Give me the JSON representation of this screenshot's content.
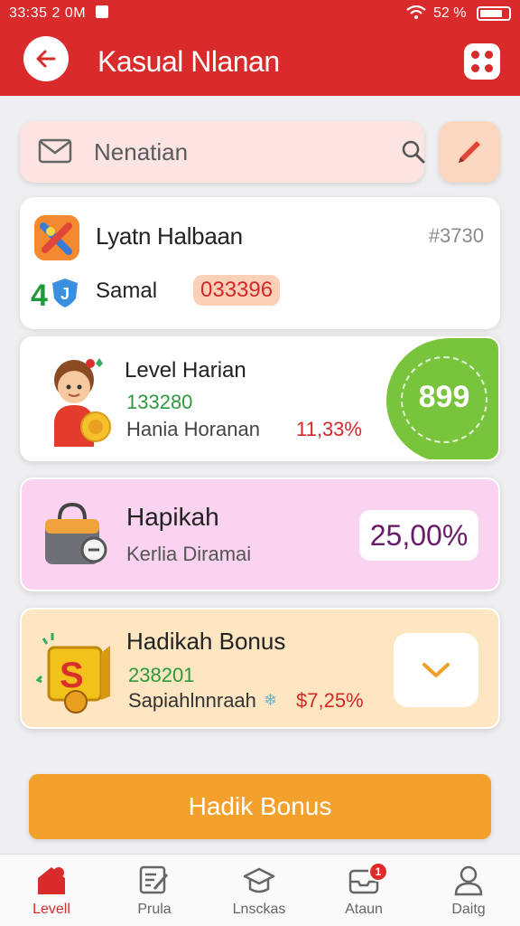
{
  "status_bar": {
    "time": "33:35 2 0M",
    "battery_text": "52 %"
  },
  "header": {
    "title": "Kasual Nlanan"
  },
  "search": {
    "placeholder": "Nenatian"
  },
  "summary": {
    "name": "Lyatn Halbaan",
    "code": "#3730",
    "level_number": "4",
    "subname": "Samal",
    "badge": "033396"
  },
  "level_card": {
    "title": "Level Harian",
    "value": "133280",
    "subtitle": "Hania Horanan",
    "percent": "11,33%",
    "score": "899"
  },
  "pink_card": {
    "title": "Hapikah",
    "subtitle": "Kerlia Diramai",
    "percent": "25,00%"
  },
  "bonus_card": {
    "title": "Hadikah Bonus",
    "value": "238201",
    "subtitle": "Sapiahlnnraah",
    "percent": "$7,25%"
  },
  "cta": {
    "label": "Hadik Bonus"
  },
  "bottom_nav": {
    "items": [
      {
        "label": "Levell",
        "icon": "home-icon"
      },
      {
        "label": "Prula",
        "icon": "edit-note-icon"
      },
      {
        "label": "Lnsckas",
        "icon": "graduation-icon"
      },
      {
        "label": "Ataun",
        "icon": "inbox-icon",
        "badge": "1"
      },
      {
        "label": "Daitg",
        "icon": "profile-icon"
      }
    ]
  },
  "colors": {
    "primary": "#d92b2b",
    "accent": "#f4a02c",
    "green": "#78c43c",
    "pink_card": "#f9d3ef",
    "bonus_card": "#fde6c1"
  }
}
